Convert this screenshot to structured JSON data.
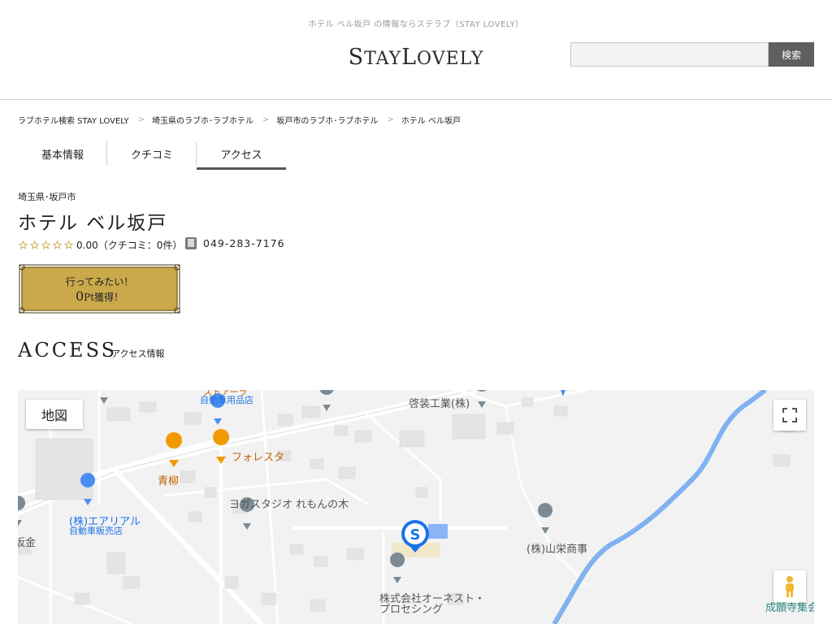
{
  "header": {
    "tagline": "ホテル ベル坂戸 の情報ならステラブ（STAY LOVELY）",
    "logo": {
      "part1": "S",
      "part2": "TAY",
      "part3": "L",
      "part4": "OVELY"
    },
    "search": {
      "value": "",
      "button_label": "検索"
    }
  },
  "breadcrumb": [
    "ラブホテル検索 STAY LOVELY",
    "埼玉県のラブホ･ラブホテル",
    "坂戸市のラブホ･ラブホテル",
    "ホテル ベル坂戸"
  ],
  "breadcrumb_separator": ">",
  "tabs": [
    {
      "label": "基本情報",
      "active": false
    },
    {
      "label": "クチコミ",
      "active": false
    },
    {
      "label": "アクセス",
      "active": true
    }
  ],
  "hotel": {
    "location": "埼玉県･坂戸市",
    "name": "ホテル ベル坂戸",
    "rating": "0.00",
    "stars_filled": 0,
    "stars_total": 5,
    "review_count": "（クチコミ：0件）",
    "phone": "049-283-7176"
  },
  "wish": {
    "line1": "行ってみたい！",
    "points_value": "0",
    "points_unit": "Pt",
    "points_suffix": "獲得！"
  },
  "access": {
    "title": "ACCESS",
    "subtitle": "アクセス情報"
  },
  "map": {
    "type_label": "地図",
    "labels": {
      "store_top": "ストアーラ",
      "auto_parts": "自動車用品店",
      "keiso": "啓装工業(株)",
      "forester": "フォレスタ",
      "aoyagi": "青柳",
      "yoga": "ヨガスタジオ れもんの木",
      "aerial": "(株)エアリアル",
      "aerial_sub": "自動車販売店",
      "kin": "坂金",
      "sanei": "(株)山栄商事",
      "honest1": "株式会社オーネスト・",
      "honest2": "プロセシング",
      "jooji": "成願寺集会"
    },
    "colors": {
      "river": "#7fb2ef",
      "pin": "#7b8a94",
      "food_pin": "#f29900",
      "shop_pin": "#4a8ff0",
      "hotel_pin": "#1a73e8"
    }
  },
  "colors": {
    "accent_gold": "#c9a94a",
    "tab_underline": "#555555",
    "search_button": "#5f5f5f"
  }
}
